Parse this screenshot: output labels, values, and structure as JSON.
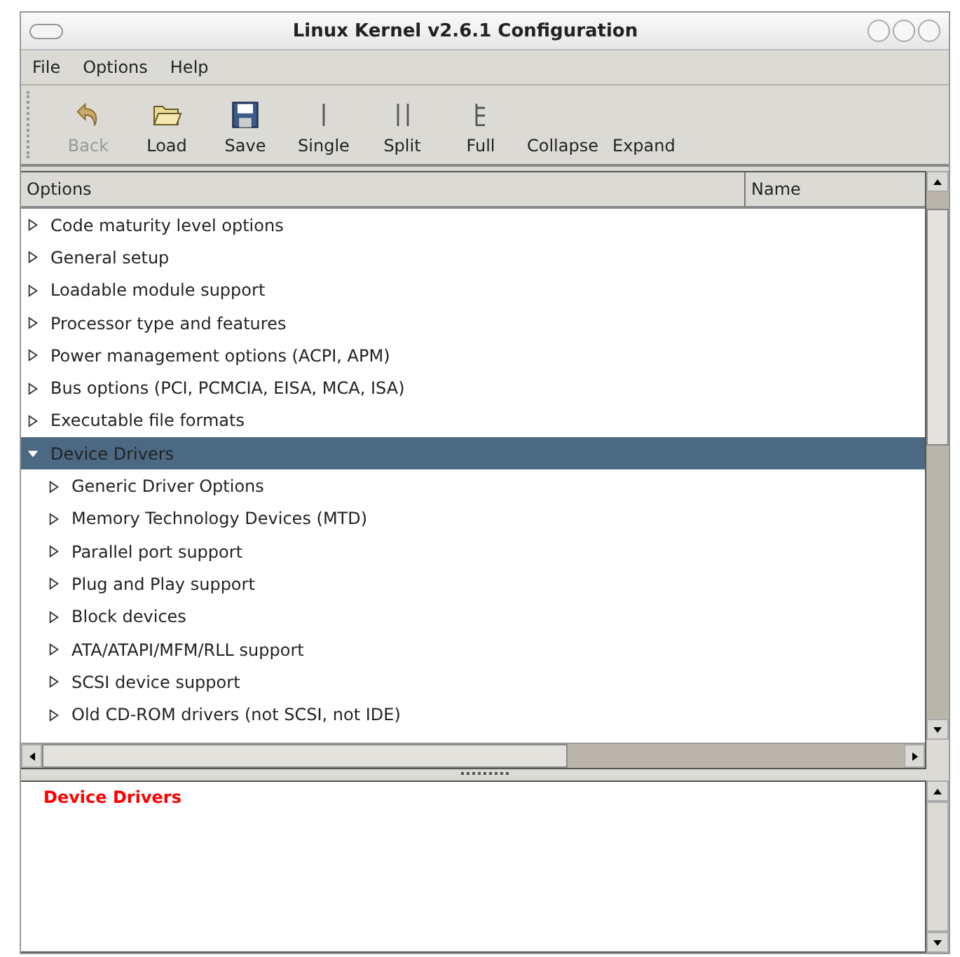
{
  "window": {
    "title": "Linux Kernel v2.6.1 Configuration"
  },
  "menu": [
    "File",
    "Options",
    "Help"
  ],
  "toolbar": [
    {
      "label": "Back",
      "kind": "back",
      "disabled": true
    },
    {
      "label": "Load",
      "kind": "load",
      "disabled": false
    },
    {
      "label": "Save",
      "kind": "save",
      "disabled": false
    },
    {
      "label": "Single",
      "kind": "single",
      "disabled": false
    },
    {
      "label": "Split",
      "kind": "split",
      "disabled": false
    },
    {
      "label": "Full",
      "kind": "full",
      "disabled": false
    },
    {
      "label": "Collapse",
      "kind": "text",
      "disabled": false
    },
    {
      "label": "Expand",
      "kind": "text",
      "disabled": false
    }
  ],
  "tree": {
    "columns": [
      "Options",
      "Name"
    ],
    "items": [
      {
        "label": "Code maturity level options",
        "expanded": false,
        "selected": false
      },
      {
        "label": "General setup",
        "expanded": false,
        "selected": false
      },
      {
        "label": "Loadable module support",
        "expanded": false,
        "selected": false
      },
      {
        "label": "Processor type and features",
        "expanded": false,
        "selected": false
      },
      {
        "label": "Power management options (ACPI, APM)",
        "expanded": false,
        "selected": false
      },
      {
        "label": "Bus options (PCI, PCMCIA, EISA, MCA, ISA)",
        "expanded": false,
        "selected": false
      },
      {
        "label": "Executable file formats",
        "expanded": false,
        "selected": false
      },
      {
        "label": "Device Drivers",
        "expanded": true,
        "selected": true,
        "children": [
          {
            "label": "Generic Driver Options",
            "expanded": false,
            "selected": false
          },
          {
            "label": "Memory Technology Devices (MTD)",
            "expanded": false,
            "selected": false
          },
          {
            "label": "Parallel port support",
            "expanded": false,
            "selected": false
          },
          {
            "label": "Plug and Play support",
            "expanded": false,
            "selected": false
          },
          {
            "label": "Block devices",
            "expanded": false,
            "selected": false
          },
          {
            "label": "ATA/ATAPI/MFM/RLL support",
            "expanded": false,
            "selected": false
          },
          {
            "label": "SCSI device support",
            "expanded": false,
            "selected": false
          },
          {
            "label": "Old CD-ROM drivers (not SCSI, not IDE)",
            "expanded": false,
            "selected": false
          }
        ]
      }
    ]
  },
  "help": {
    "title": "Device Drivers"
  }
}
